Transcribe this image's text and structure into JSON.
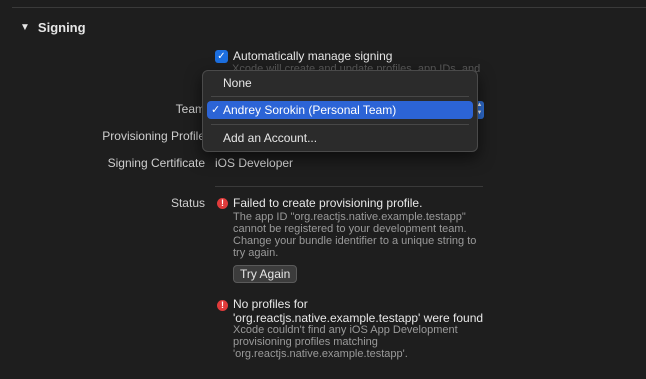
{
  "section": {
    "title": "Signing"
  },
  "auto_signing": {
    "label": "Automatically manage signing",
    "checked": true
  },
  "hint_fragment": "Xcode will create and update profiles, app IDs, and",
  "fields": {
    "team_label": "Team",
    "profile_label": "Provisioning Profile",
    "certificate_label": "Signing Certificate",
    "certificate_value": "iOS Developer",
    "status_label": "Status"
  },
  "team_menu": {
    "items": [
      {
        "label": "None",
        "selected": false
      },
      {
        "label": "Andrey Sorokin (Personal Team)",
        "selected": true
      },
      {
        "label": "Add an Account...",
        "selected": false
      }
    ]
  },
  "errors": [
    {
      "title": "Failed to create provisioning profile.",
      "description_lines": [
        "The app ID \"org.reactjs.native.example.testapp\"",
        "cannot be registered to your development team.",
        "Change your bundle identifier to a unique string to",
        "try again."
      ],
      "button": "Try Again"
    },
    {
      "title_lines": [
        "No profiles for",
        "'org.reactjs.native.example.testapp' were found"
      ],
      "description_lines": [
        "Xcode couldn't find any iOS App Development",
        "provisioning profiles matching",
        "'org.reactjs.native.example.testapp'."
      ]
    }
  ],
  "colors": {
    "accent": "#2c64d6",
    "error": "#e03b3b",
    "background": "#1e1e1e"
  }
}
